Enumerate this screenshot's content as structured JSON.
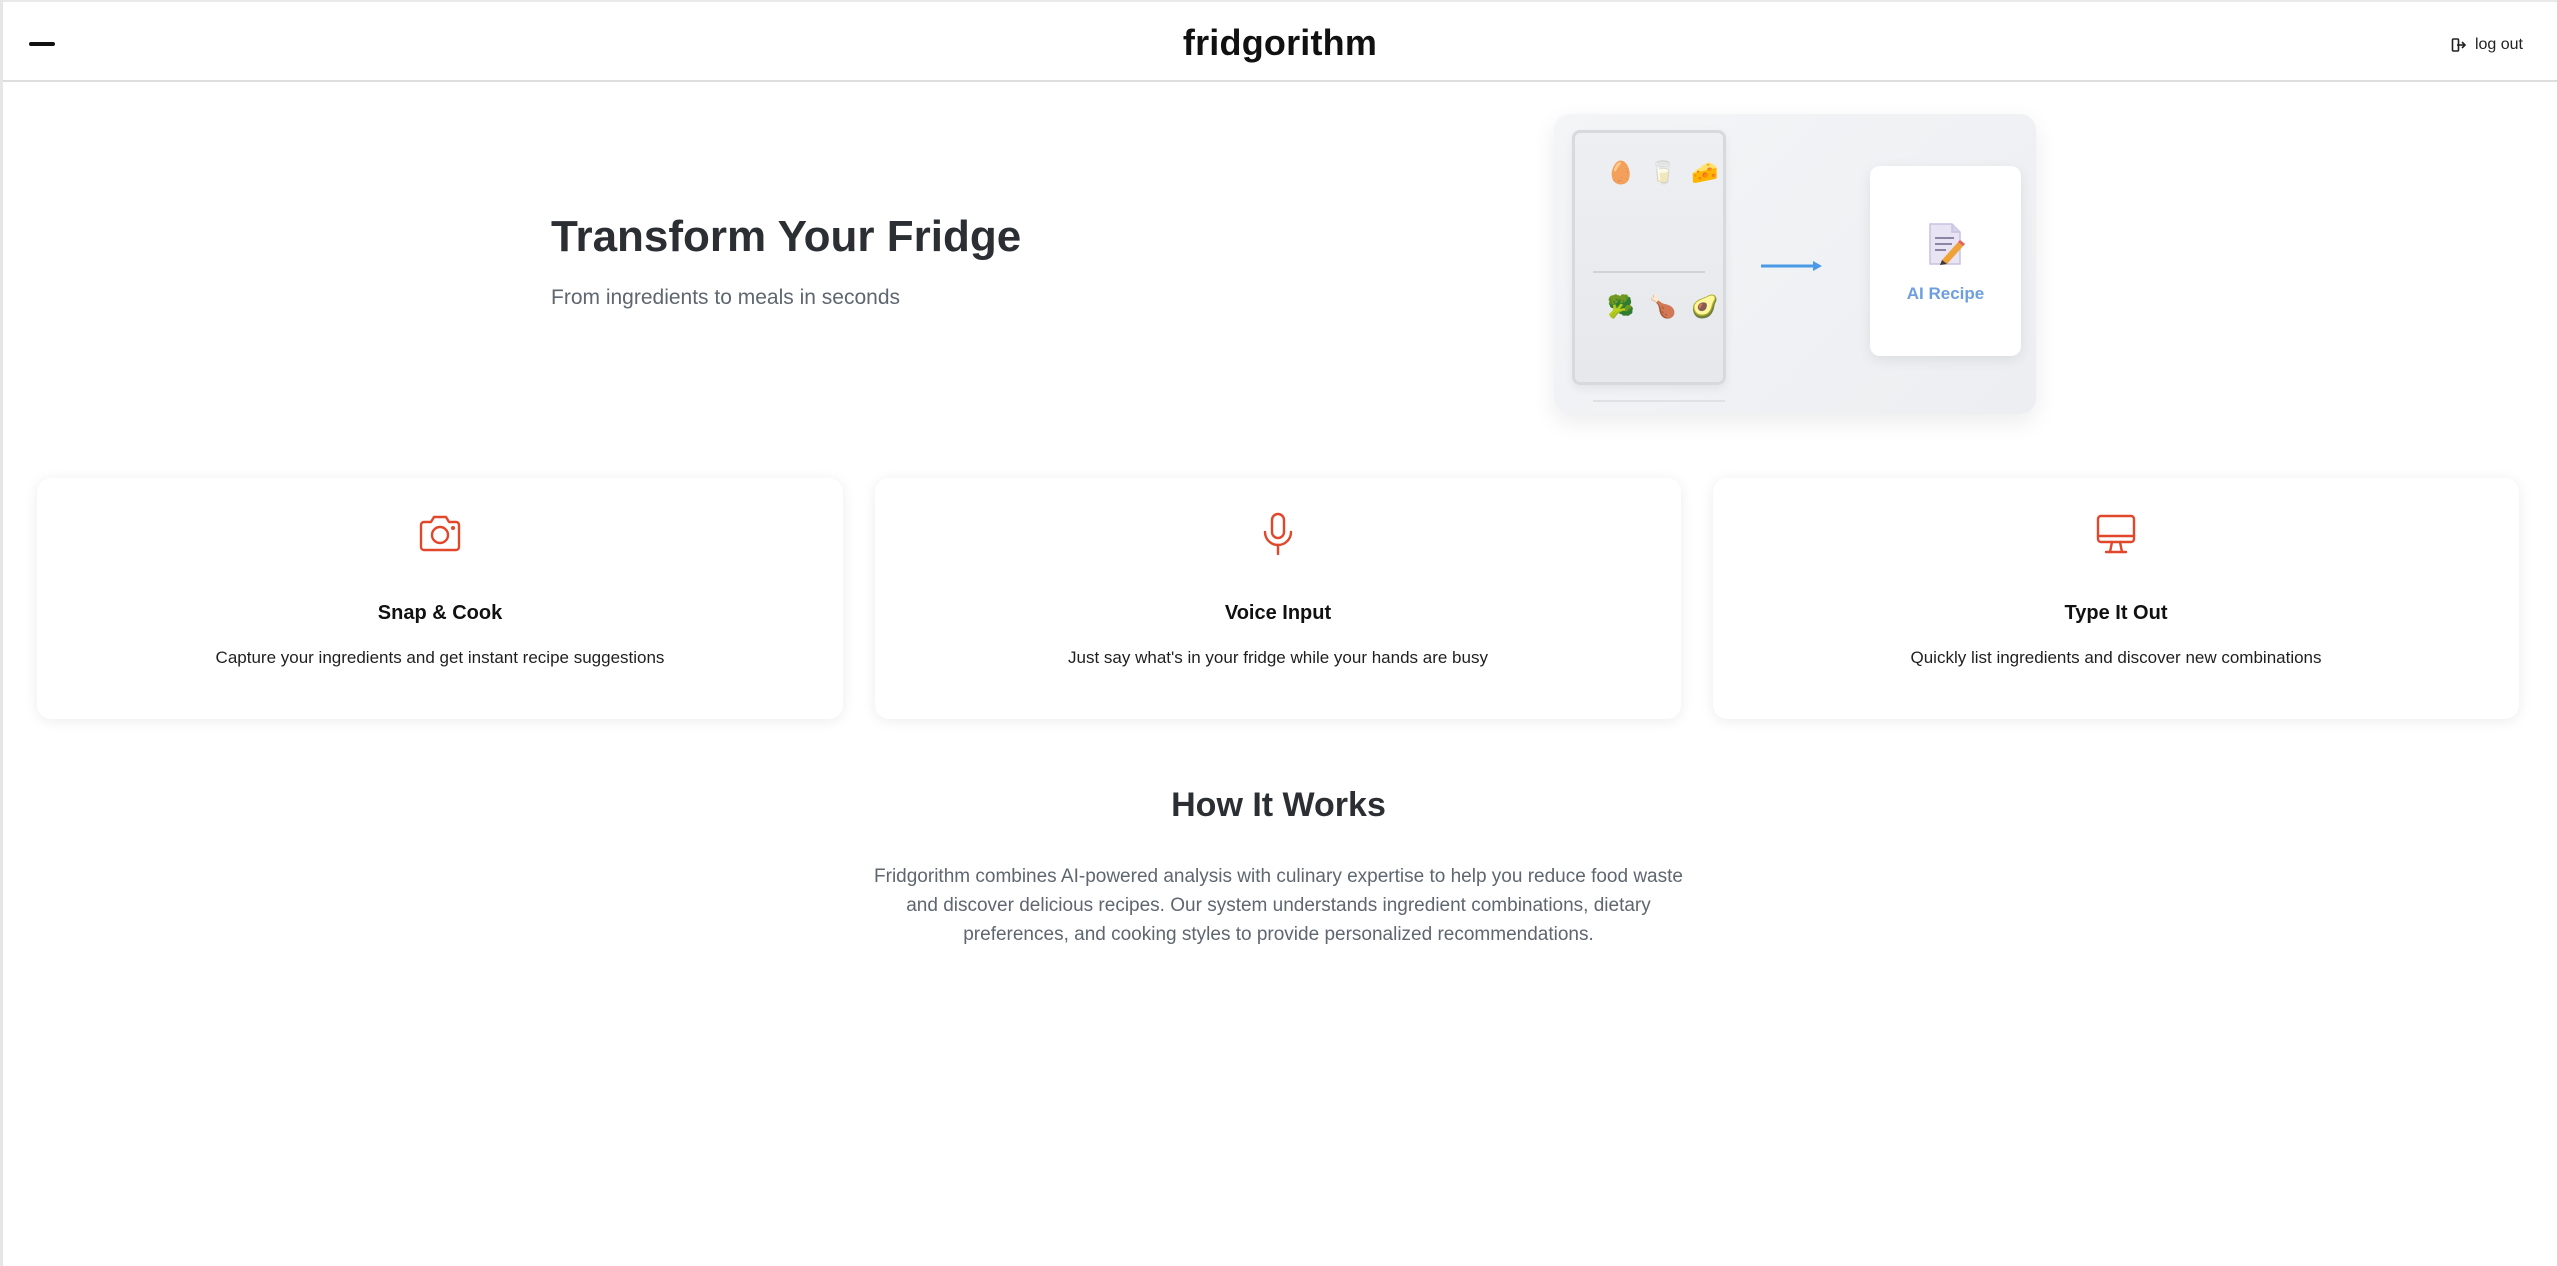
{
  "header": {
    "brand": "fridgorithm",
    "menu_icon": "hamburger-menu-icon",
    "logout_label": "log out",
    "logout_icon": "logout-icon"
  },
  "hero": {
    "title": "Transform Your Fridge",
    "subtitle": "From ingredients to meals in seconds",
    "illustration": {
      "fridge_items_top": [
        "🥚",
        "🥛",
        "🧀"
      ],
      "fridge_items_bottom": [
        "🥦",
        "🍗",
        "🥑"
      ],
      "arrow_icon": "arrow-right-icon",
      "recipe_icon": "recipe-document-icon",
      "recipe_label": "AI Recipe"
    }
  },
  "features": [
    {
      "icon": "camera-icon",
      "title": "Snap & Cook",
      "description": "Capture your ingredients and get instant recipe suggestions"
    },
    {
      "icon": "microphone-icon",
      "title": "Voice Input",
      "description": "Just say what's in your fridge while your hands are busy"
    },
    {
      "icon": "monitor-icon",
      "title": "Type It Out",
      "description": "Quickly list ingredients and discover new combinations"
    }
  ],
  "how_it_works": {
    "title": "How It Works",
    "body": "Fridgorithm combines AI-powered analysis with culinary expertise to help you reduce food waste and discover delicious recipes. Our system understands ingredient combinations, dietary preferences, and cooking styles to provide personalized recommendations."
  },
  "colors": {
    "accent_icon": "#e0472b",
    "recipe_label": "#6d9fe0",
    "arrow": "#4a9ae8",
    "heading": "#2b2f33",
    "muted_text": "#5e6670"
  }
}
